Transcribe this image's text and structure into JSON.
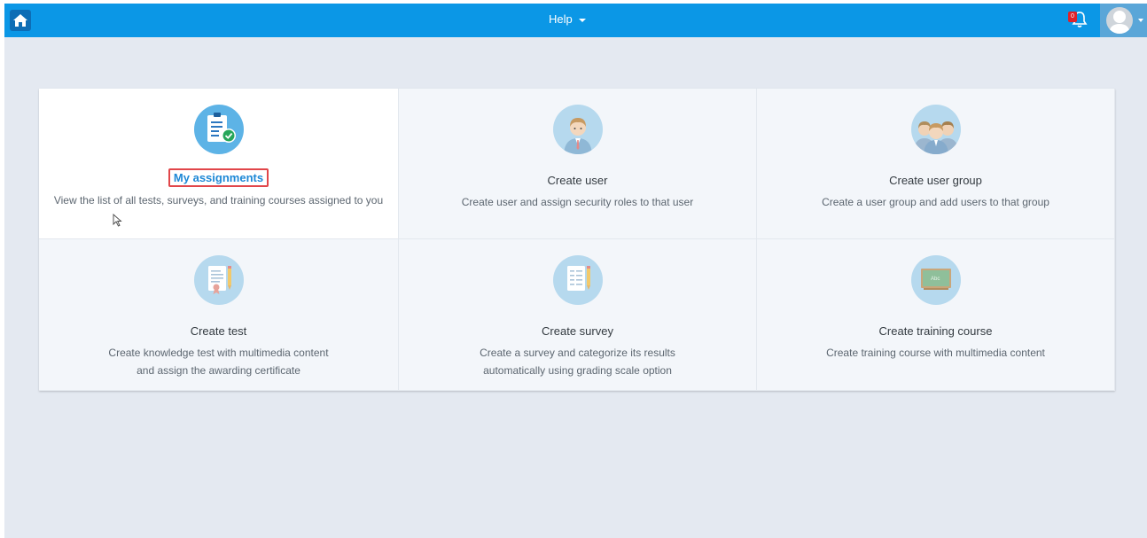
{
  "topbar": {
    "help_label": "Help",
    "notification_count": "0"
  },
  "tiles": [
    {
      "title": "My assignments",
      "description": "View the list of all tests, surveys, and training courses assigned to you",
      "icon": "clipboard-check-icon"
    },
    {
      "title": "Create user",
      "description": "Create user and assign security roles to that user",
      "icon": "user-icon"
    },
    {
      "title": "Create user group",
      "description": "Create a user group and add users to that group",
      "icon": "user-group-icon"
    },
    {
      "title": "Create test",
      "description_line1": "Create knowledge test with multimedia content",
      "description_line2": "and assign the awarding certificate",
      "icon": "certificate-test-icon"
    },
    {
      "title": "Create survey",
      "description_line1": "Create a survey and categorize its results",
      "description_line2": "automatically using grading scale option",
      "icon": "survey-icon"
    },
    {
      "title": "Create training course",
      "description": "Create training course with multimedia content",
      "icon": "chalkboard-icon",
      "icon_text": "Abc"
    }
  ],
  "colors": {
    "topbar": "#0b97e6",
    "background": "#e4e9f1",
    "highlight_border": "#e1464a",
    "link_blue": "#1e88d6"
  }
}
